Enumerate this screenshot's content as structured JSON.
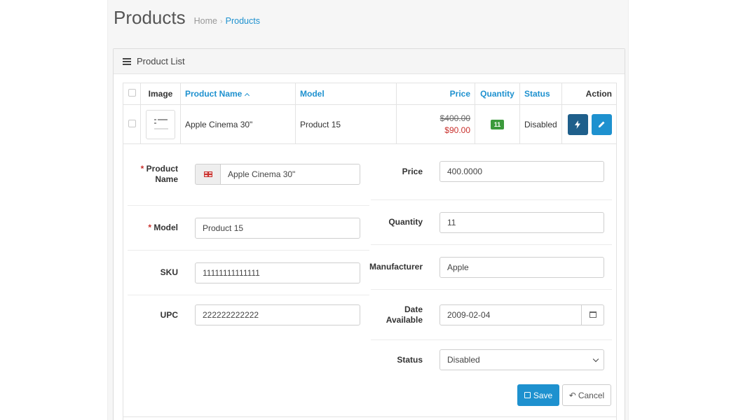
{
  "header": {
    "title": "Products",
    "breadcrumb": {
      "home": "Home",
      "separator": "›",
      "current": "Products"
    }
  },
  "panel": {
    "title": "Product List",
    "icon": "list-icon"
  },
  "table": {
    "columns": {
      "image": "Image",
      "name": "Product Name",
      "model": "Model",
      "price": "Price",
      "quantity": "Quantity",
      "status": "Status",
      "action": "Action"
    },
    "sort": {
      "column": "Product Name",
      "direction": "ascending"
    },
    "rows": [
      {
        "name": "Apple Cinema 30\"",
        "model": "Product 15",
        "price_old": "$400.00",
        "price_special": "$90.00",
        "quantity": "11",
        "status": "Disabled"
      }
    ]
  },
  "editor": {
    "name_label": "Product Name",
    "name_value": "Apple Cinema 30\"",
    "model_label": "Model",
    "model_value": "Product 15",
    "sku_label": "SKU",
    "sku_value": "11111111111111",
    "upc_label": "UPC",
    "upc_value": "222222222222",
    "price_label": "Price",
    "price_value": "400.0000",
    "quantity_label": "Quantity",
    "quantity_value": "11",
    "manufacturer_label": "Manufacturer",
    "manufacturer_value": "Apple",
    "date_label": "Date Available",
    "date_value": "2009-02-04",
    "status_label": "Status",
    "status_value": "Disabled",
    "required_mark": "*",
    "save_label": "Save",
    "cancel_label": "Cancel"
  },
  "colors": {
    "link": "#1e91cf",
    "primary_button": "#1e91cf",
    "dark_button": "#1f5f8b",
    "special_price": "#c9302c",
    "quantity_badge": "#3c9a3c"
  }
}
